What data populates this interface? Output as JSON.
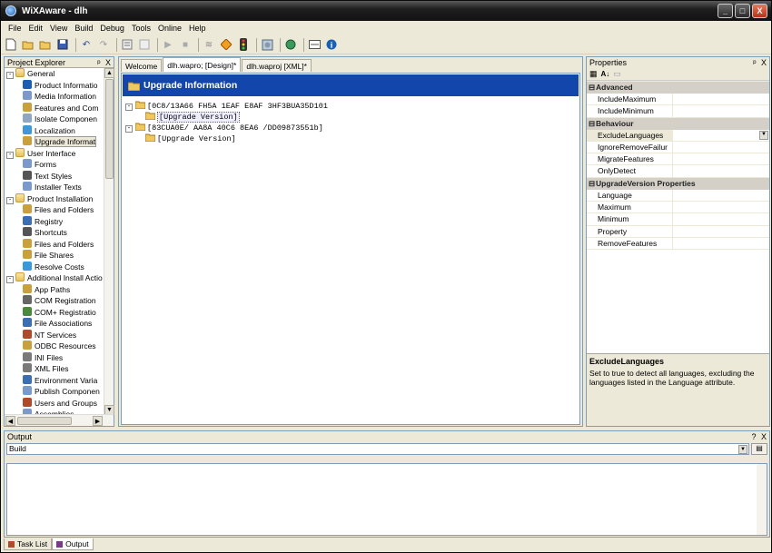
{
  "window": {
    "title": "WiXAware - dlh",
    "minimize_icon": "_",
    "maximize_icon": "□",
    "close_icon": "X"
  },
  "menu": [
    "File",
    "Edit",
    "View",
    "Build",
    "Debug",
    "Tools",
    "Online",
    "Help"
  ],
  "project_explorer": {
    "title": "Project Explorer",
    "pin": "ᵖ",
    "close": "X",
    "items": [
      {
        "label": "General",
        "level": 0,
        "type": "folder",
        "expand": "-"
      },
      {
        "label": "Product Informatio",
        "level": 1,
        "type": "info-icon",
        "color": "#1a5fb4"
      },
      {
        "label": "Media Information",
        "level": 1,
        "type": "media-icon",
        "color": "#7a9acc"
      },
      {
        "label": "Features and Com",
        "level": 1,
        "type": "features-icon",
        "color": "#c9a03c"
      },
      {
        "label": "Isolate Componen",
        "level": 1,
        "type": "isolate-icon",
        "color": "#8fa6c4"
      },
      {
        "label": "Localization",
        "level": 1,
        "type": "globe-icon",
        "color": "#3a9ad9"
      },
      {
        "label": "Upgrade Informat",
        "level": 1,
        "type": "upgrade-icon",
        "color": "#c9a03c",
        "selected": true
      },
      {
        "label": "User Interface",
        "level": 0,
        "type": "folder",
        "expand": "-"
      },
      {
        "label": "Forms",
        "level": 1,
        "type": "forms-icon",
        "color": "#7a9acc"
      },
      {
        "label": "Text Styles",
        "level": 1,
        "type": "text-styles-icon",
        "color": "#555555"
      },
      {
        "label": "Installer Texts",
        "level": 1,
        "type": "texts-icon",
        "color": "#7a9acc"
      },
      {
        "label": "Product Installation",
        "level": 0,
        "type": "folder",
        "expand": "-"
      },
      {
        "label": "Files and Folders",
        "level": 1,
        "type": "files-icon",
        "color": "#c9a03c"
      },
      {
        "label": "Registry",
        "level": 1,
        "type": "registry-icon",
        "color": "#3a6fb4"
      },
      {
        "label": "Shortcuts",
        "level": 1,
        "type": "shortcut-icon",
        "color": "#555555"
      },
      {
        "label": "Files and Folders",
        "level": 1,
        "type": "files-icon",
        "color": "#c9a03c"
      },
      {
        "label": "File Shares",
        "level": 1,
        "type": "share-icon",
        "color": "#c9a03c"
      },
      {
        "label": "Resolve Costs",
        "level": 1,
        "type": "costs-icon",
        "color": "#3a9ad9"
      },
      {
        "label": "Additional Install Actio",
        "level": 0,
        "type": "folder",
        "expand": "-"
      },
      {
        "label": "App Paths",
        "level": 1,
        "type": "app-paths-icon",
        "color": "#c9a03c"
      },
      {
        "label": "COM Registration",
        "level": 1,
        "type": "com-icon",
        "color": "#666666"
      },
      {
        "label": "COM+ Registratio",
        "level": 1,
        "type": "complus-icon",
        "color": "#4a8a3a"
      },
      {
        "label": "File Associations",
        "level": 1,
        "type": "file-assoc-icon",
        "color": "#3a6fb4"
      },
      {
        "label": "NT Services",
        "level": 1,
        "type": "services-icon",
        "color": "#b04a2a"
      },
      {
        "label": "ODBC Resources",
        "level": 1,
        "type": "odbc-icon",
        "color": "#c9a03c"
      },
      {
        "label": "INI Files",
        "level": 1,
        "type": "ini-icon",
        "color": "#7a7a7a"
      },
      {
        "label": "XML Files",
        "level": 1,
        "type": "xml-icon",
        "color": "#7a7a7a"
      },
      {
        "label": "Environment Varia",
        "level": 1,
        "type": "env-icon",
        "color": "#3a6fb4"
      },
      {
        "label": "Publish Componen",
        "level": 1,
        "type": "publish-icon",
        "color": "#7a9acc"
      },
      {
        "label": "Users and Groups",
        "level": 1,
        "type": "users-icon",
        "color": "#b04a2a"
      },
      {
        "label": "Assemblies",
        "level": 1,
        "type": "assemblies-icon",
        "color": "#7a9acc"
      }
    ]
  },
  "editor": {
    "tabs": [
      {
        "label": "Welcome",
        "active": false
      },
      {
        "label": "dlh.wapro; [Design]*",
        "active": true
      },
      {
        "label": "dlh.waproj [XML]*",
        "active": false
      }
    ],
    "banner": "Upgrade Information",
    "tree": [
      {
        "label": "[0C8/13A66 FH5A 1EAF E8AF 3HF3BUA35D101",
        "level": 0,
        "expand": "-"
      },
      {
        "label": "[Upgrade Version]",
        "level": 1,
        "selected": true
      },
      {
        "label": "[83CUA0E/ AA8A 40C6 8EA6 /DD09873551b]",
        "level": 0,
        "expand": "-"
      },
      {
        "label": "[Upgrade Version]",
        "level": 1,
        "selected": false
      }
    ]
  },
  "properties": {
    "title": "Properties",
    "pin": "ᵖ",
    "close": "X",
    "categories": [
      {
        "name": "Advanced",
        "rows": [
          {
            "key": "IncludeMaximum",
            "value": ""
          },
          {
            "key": "IncludeMinimum",
            "value": ""
          }
        ]
      },
      {
        "name": "Behaviour",
        "rows": [
          {
            "key": "ExcludeLanguages",
            "value": "",
            "selected": true
          },
          {
            "key": "IgnoreRemoveFailur",
            "value": ""
          },
          {
            "key": "MigrateFeatures",
            "value": ""
          },
          {
            "key": "OnlyDetect",
            "value": ""
          }
        ]
      },
      {
        "name": "UpgradeVersion Properties",
        "rows": [
          {
            "key": "Language",
            "value": ""
          },
          {
            "key": "Maximum",
            "value": ""
          },
          {
            "key": "Minimum",
            "value": ""
          },
          {
            "key": "Property",
            "value": ""
          },
          {
            "key": "RemoveFeatures",
            "value": ""
          }
        ]
      }
    ],
    "desc_title": "ExcludeLanguages",
    "desc_text": "Set to true to detect all languages, excluding the languages listed in the Language attribute."
  },
  "output": {
    "title": "Output",
    "help": "?",
    "close": "X",
    "source": "Build"
  },
  "bottom_tabs": [
    {
      "label": "Task List",
      "active": false,
      "color": "#b04a2a"
    },
    {
      "label": "Output",
      "active": true,
      "color": "#7a3a8a"
    }
  ]
}
